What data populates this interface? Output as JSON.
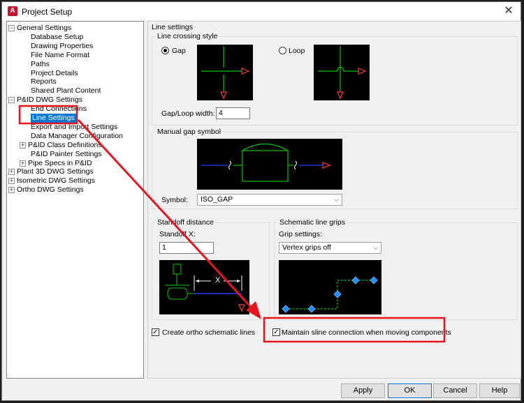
{
  "window": {
    "title": "Project Setup",
    "app_icon_letter": "A",
    "close_glyph": "✕"
  },
  "tree": {
    "nodes": [
      {
        "label": "General Settings",
        "expander": "−"
      },
      {
        "label": "Database Setup"
      },
      {
        "label": "Drawing Properties"
      },
      {
        "label": "File Name Format"
      },
      {
        "label": "Paths"
      },
      {
        "label": "Project Details"
      },
      {
        "label": "Reports"
      },
      {
        "label": "Shared Plant Content"
      },
      {
        "label": "P&ID DWG Settings",
        "expander": "−"
      },
      {
        "label": "End Connections"
      },
      {
        "label": "Line Settings",
        "selected": true
      },
      {
        "label": "Export and Import Settings"
      },
      {
        "label": "Data Manager Configuration"
      },
      {
        "label": "P&ID Class Definitions",
        "expander": "+"
      },
      {
        "label": "P&ID Painter Settings"
      },
      {
        "label": "Pipe Specs in P&ID",
        "expander": "+"
      },
      {
        "label": "Plant 3D DWG Settings",
        "expander": "+"
      },
      {
        "label": "Isometric DWG Settings",
        "expander": "+"
      },
      {
        "label": "Ortho DWG Settings",
        "expander": "+"
      }
    ]
  },
  "panel": {
    "header": "Line settings",
    "crossing": {
      "title": "Line crossing style",
      "gap_label": "Gap",
      "loop_label": "Loop",
      "selected": "Gap",
      "width_label": "Gap/Loop width:",
      "width_value": "4"
    },
    "manual_gap": {
      "title": "Manual gap symbol",
      "symbol_label": "Symbol:",
      "symbol_value": "ISO_GAP"
    },
    "standoff": {
      "title": "Standoff distance",
      "x_label": "Standoff X:",
      "x_value": "1",
      "diagram_x": "X"
    },
    "grips": {
      "title": "Schematic line grips",
      "settings_label": "Grip settings:",
      "settings_value": "Vertex grips off"
    },
    "ortho_checkbox": {
      "label": "Create ortho schematic lines",
      "checked": true
    },
    "maintain_checkbox": {
      "label": "Maintain sline connection when moving components",
      "checked": true
    }
  },
  "buttons": {
    "apply": "Apply",
    "ok": "OK",
    "cancel": "Cancel",
    "help": "Help"
  },
  "colors": {
    "annotation_red": "#e8141e",
    "selection_blue": "#0078d7",
    "line_green": "#00c800",
    "line_blue": "#1e3cff",
    "arrow_red": "#ff3a3a",
    "grip_blue": "#1e8cff"
  }
}
